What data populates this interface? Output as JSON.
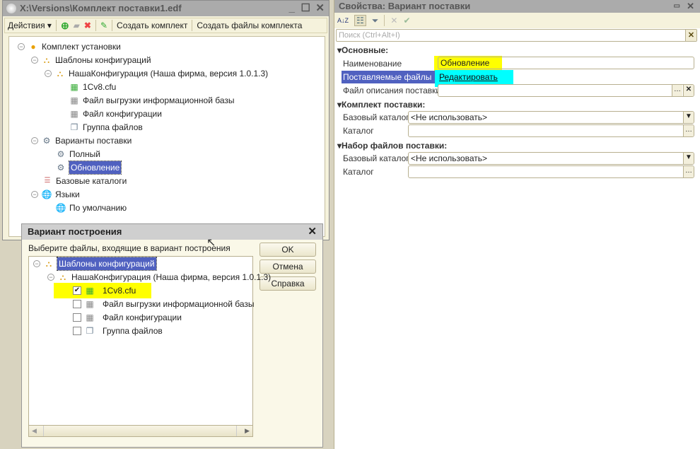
{
  "main_window": {
    "title": "X:\\Versions\\Комплект поставки1.edf",
    "toolbar": {
      "actions": "Действия",
      "create_kit": "Создать комплект",
      "create_kit_files": "Создать файлы комплекта"
    },
    "tree": {
      "root": "Комплект установки",
      "templates": "Шаблоны конфигураций",
      "config": "НашаКонфигурация (Наша фирма, версия 1.0.1.3)",
      "files": [
        "1Cv8.cfu",
        "Файл выгрузки информационной базы",
        "Файл конфигурации",
        "Группа файлов"
      ],
      "variants": "Варианты поставки",
      "variant_items": [
        "Полный",
        "Обновление"
      ],
      "base_dirs": "Базовые каталоги",
      "languages": "Языки",
      "default_lang": "По умолчанию"
    }
  },
  "dialog": {
    "title": "Вариант построения",
    "prompt": "Выберите файлы, входящие в вариант построения",
    "buttons": {
      "ok": "OK",
      "cancel": "Отмена",
      "help": "Справка"
    },
    "tree": {
      "templates": "Шаблоны конфигураций",
      "config": "НашаКонфигурация (Наша фирма, версия 1.0.1.3)",
      "files": [
        {
          "label": "1Cv8.cfu",
          "checked": true
        },
        {
          "label": "Файл выгрузки информационной базы",
          "checked": false
        },
        {
          "label": "Файл конфигурации",
          "checked": false
        },
        {
          "label": "Группа файлов",
          "checked": false
        }
      ]
    }
  },
  "properties": {
    "title": "Свойства: Вариант поставки",
    "search_placeholder": "Поиск (Ctrl+Alt+I)",
    "sections": {
      "main": "Основные:",
      "kit": "Комплект поставки:",
      "fileset": "Набор файлов поставки:"
    },
    "labels": {
      "name": "Наименование",
      "files": "Поставляемые файлы",
      "desc": "Файл описания поставки",
      "base_dir": "Базовый каталог",
      "dir": "Каталог"
    },
    "values": {
      "name": "Обновление",
      "files_link": "Редактировать",
      "kit_base_dir": "<Не использовать>",
      "fileset_base_dir": "<Не использовать>"
    }
  },
  "colors": {
    "highlight_yellow": "#ffff00",
    "highlight_cyan": "#00ffff",
    "selection": "#5061c0"
  }
}
